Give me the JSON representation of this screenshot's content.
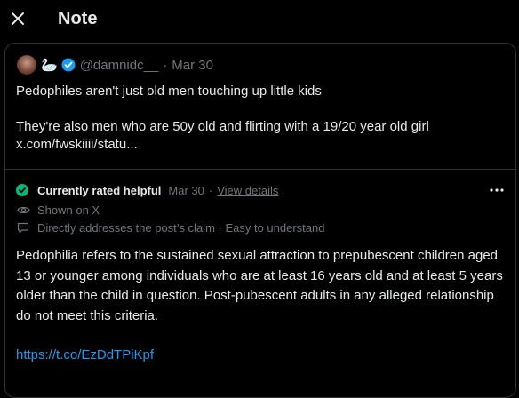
{
  "header": {
    "title": "Note",
    "close_icon": "close-icon"
  },
  "quoted_post": {
    "emoji": "🦢",
    "handle": "@damnidc__",
    "separator": "·",
    "date": "Mar 30",
    "text_line1": "Pedophiles aren't just old men touching up little kids",
    "text_line2": "They're also men who are 50y old and flirting with a 19/20 year old girl",
    "link": "x.com/fwskiiii/statu..."
  },
  "note": {
    "status": "Currently rated helpful",
    "date": "Mar 30",
    "separator": "·",
    "details_link": "View details",
    "shown_on": "Shown on X",
    "reasons": "Directly addresses the post’s claim · Easy to understand",
    "body": "Pedophilia refers to the sustained sexual attraction to prepubescent children aged 13 or younger among individuals who are at least 16 years old and at least 5 years older than the child in question.  Post-pubescent adults in any alleged relationship do not meet this criteria.",
    "link": "https://t.co/EzDdTPiKpf"
  },
  "colors": {
    "background": "#000000",
    "text": "#e7e9ea",
    "muted": "#71767b",
    "border": "#2f3336",
    "accent": "#1d9bf0",
    "helpful": "#00ba7c"
  }
}
